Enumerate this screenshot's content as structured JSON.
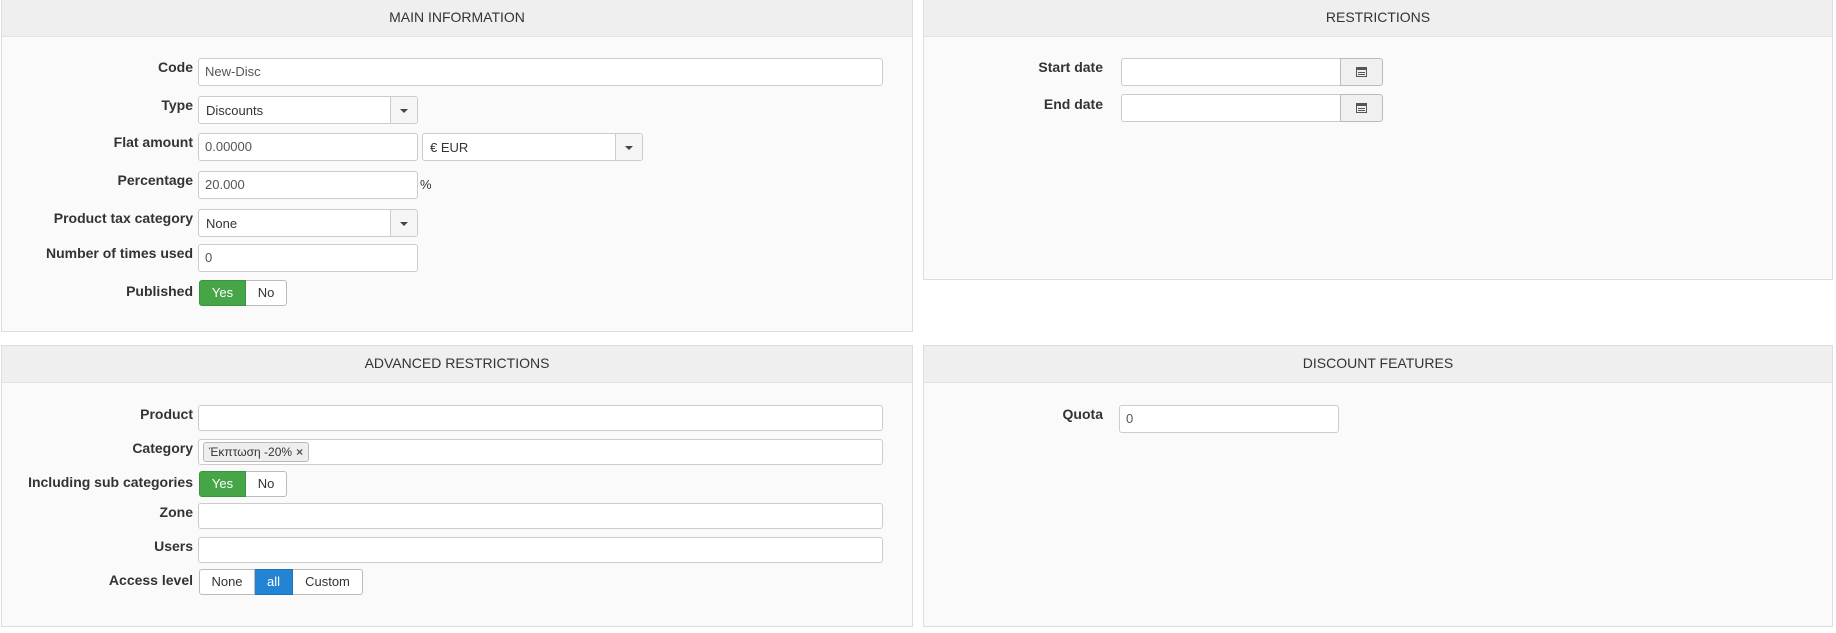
{
  "main_info": {
    "title": "MAIN INFORMATION",
    "code": {
      "label": "Code",
      "value": "New-Disc"
    },
    "type": {
      "label": "Type",
      "value": "Discounts"
    },
    "flat_amount": {
      "label": "Flat amount",
      "value": "0.00000",
      "currency": "€ EUR"
    },
    "percentage": {
      "label": "Percentage",
      "value": "20.000",
      "unit": "%"
    },
    "product_tax_category": {
      "label": "Product tax category",
      "value": "None"
    },
    "times_used": {
      "label": "Number of times used",
      "value": "0"
    },
    "published": {
      "label": "Published",
      "yes": "Yes",
      "no": "No",
      "selected": "Yes"
    }
  },
  "restrictions": {
    "title": "RESTRICTIONS",
    "start_date": {
      "label": "Start date",
      "value": ""
    },
    "end_date": {
      "label": "End date",
      "value": ""
    }
  },
  "advanced_restrictions": {
    "title": "ADVANCED RESTRICTIONS",
    "product": {
      "label": "Product",
      "value": ""
    },
    "category": {
      "label": "Category",
      "tags": [
        "Έκπτωση -20%"
      ]
    },
    "sub_categories": {
      "label": "Including sub categories",
      "yes": "Yes",
      "no": "No",
      "selected": "Yes"
    },
    "zone": {
      "label": "Zone",
      "value": ""
    },
    "users": {
      "label": "Users",
      "value": ""
    },
    "access_level": {
      "label": "Access level",
      "options": [
        "None",
        "all",
        "Custom"
      ],
      "selected": "all"
    }
  },
  "discount_features": {
    "title": "DISCOUNT FEATURES",
    "quota": {
      "label": "Quota",
      "value": "0"
    }
  },
  "colors": {
    "green": "#46a546",
    "blue": "#2384d3"
  },
  "icons": {
    "calendar": "calendar-icon",
    "dropdown": "chevron-down-icon",
    "remove_tag": "close-icon"
  }
}
